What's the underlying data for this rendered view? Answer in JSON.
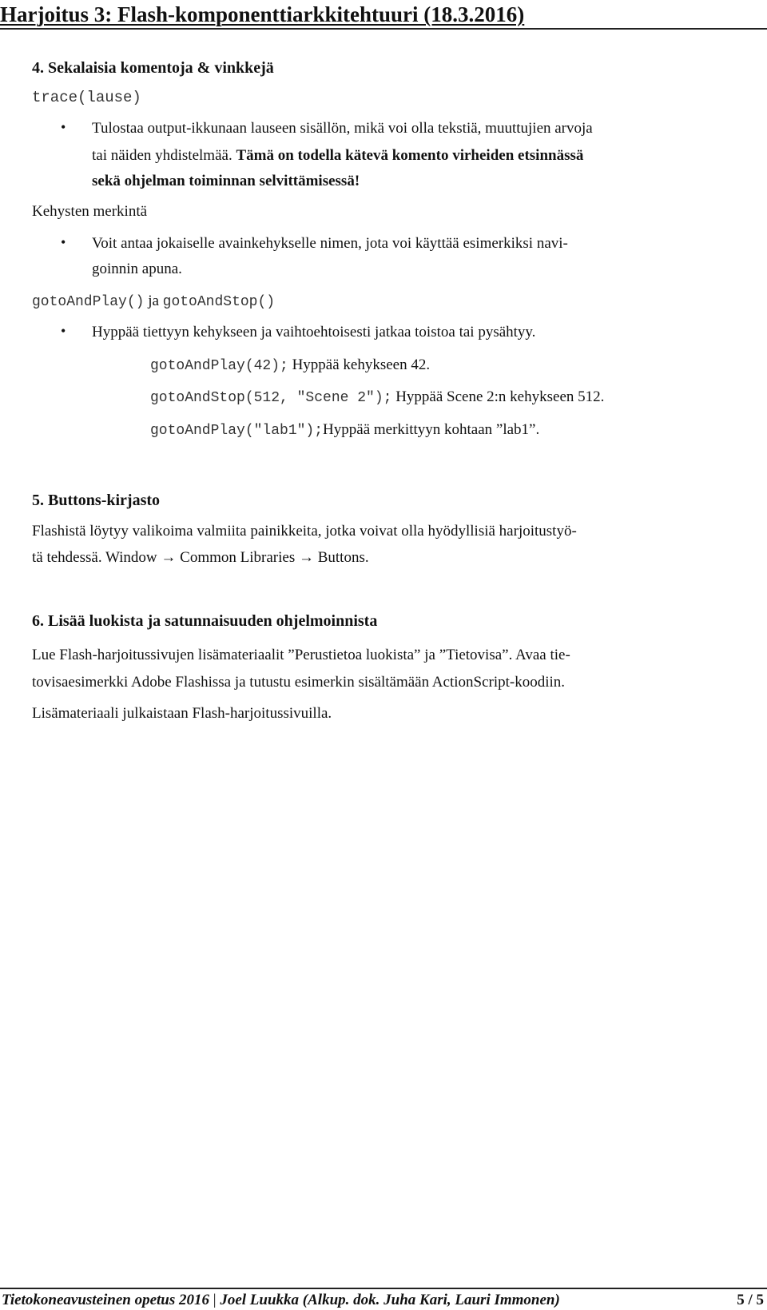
{
  "header": {
    "title": "Harjoitus 3: Flash-komponenttiarkkitehtuuri (18.3.2016)"
  },
  "section4": {
    "heading": "4. Sekalaisia komentoja & vinkkejä",
    "trace": {
      "code": "trace(lause)",
      "bullet_line1": "Tulostaa output-ikkunaan lauseen sisällön, mikä voi olla tekstiä, muuttujien arvoja",
      "bullet_line2_plain": "tai näiden yhdistelmää. ",
      "bullet_line2_bold": "Tämä on todella kätevä komento virheiden etsinnässä",
      "bullet_line3_bold": "sekä ohjelman toiminnan selvittämisessä!"
    },
    "frames": {
      "label": "Kehysten merkintä",
      "bullet_line1": "Voit antaa jokaiselle avainkehykselle nimen, jota voi käyttää esimerkiksi navi-",
      "bullet_line2": "goinnin apuna."
    },
    "goto": {
      "code1": "gotoAndPlay()",
      "joiner": " ja ",
      "code2": "gotoAndStop()",
      "bullet": "Hyppää tiettyyn kehykseen ja vaihtoehtoisesti jatkaa toistoa tai pysähtyy.",
      "examples": [
        {
          "code": "gotoAndPlay(42);",
          "text": "Hyppää kehykseen 42."
        },
        {
          "code": "gotoAndStop(512, \"Scene 2\");",
          "text": "Hyppää Scene 2:n kehykseen 512."
        },
        {
          "code": "gotoAndPlay(\"lab1\");",
          "text": "Hyppää merkittyyn kohtaan ”lab1”."
        }
      ]
    }
  },
  "section5": {
    "heading": "5. Buttons-kirjasto",
    "line1": "Flashistä löytyy valikoima valmiita painikkeita, jotka voivat olla hyödyllisiä harjoitustyö-",
    "line2": "tä tehdessä. Window → Common Libraries → Buttons."
  },
  "section6": {
    "heading": "6. Lisää luokista ja satunnaisuuden ohjelmoinnista",
    "line1": "Lue Flash-harjoitussivujen lisämateriaalit ”Perustietoa luokista” ja ”Tietovisa”. Avaa tie-",
    "line2": "tovisaesimerkki Adobe Flashissa ja tutustu esimerkin sisältämään ActionScript-koodiin.",
    "line3": "Lisämateriaali julkaistaan Flash-harjoitussivuilla."
  },
  "footer": {
    "course": "Tietokoneavusteinen opetus 2016",
    "separator": " | ",
    "authors": "Joel Luukka (Alkup. dok. Juha Kari, Lauri Immonen)",
    "page": "5 / 5"
  },
  "bullet_glyph": "•"
}
